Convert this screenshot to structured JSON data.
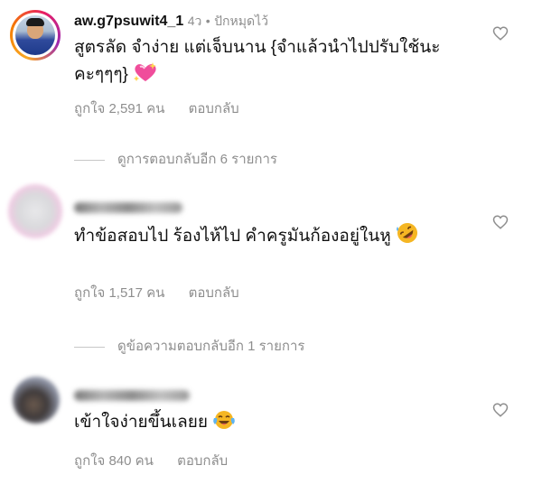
{
  "comments": [
    {
      "username": "aw.g7psuwit4_1",
      "time": "4ว",
      "pinned_label": "ปักหมุดไว้",
      "text": "สูตรลัด จำง่าย แต่เจ็บนาน {จำแล้วนำไปปรับใช้นะคะๆๆๆ}",
      "emoji": "sparkling-heart",
      "likes": "ถูกใจ 2,591 คน",
      "reply_label": "ตอบกลับ",
      "view_replies": "ดูการตอบกลับอีก 6 รายการ"
    },
    {
      "text": "ทำข้อสอบไป ร้องไห้ไป คำครูมันก้องอยู่ในหู",
      "emoji": "rolling-on-floor-laughing",
      "likes": "ถูกใจ 1,517 คน",
      "reply_label": "ตอบกลับ",
      "view_replies": "ดูข้อความตอบกลับอีก 1 รายการ"
    },
    {
      "text": "เข้าใจง่ายขึ้นเลยย",
      "emoji": "face-with-tears-of-joy",
      "likes": "ถูกใจ 840 คน",
      "reply_label": "ตอบกลับ"
    }
  ],
  "colors": {
    "text": "#111111",
    "meta": "#8e8e8e",
    "emoji": "#f5b623"
  }
}
